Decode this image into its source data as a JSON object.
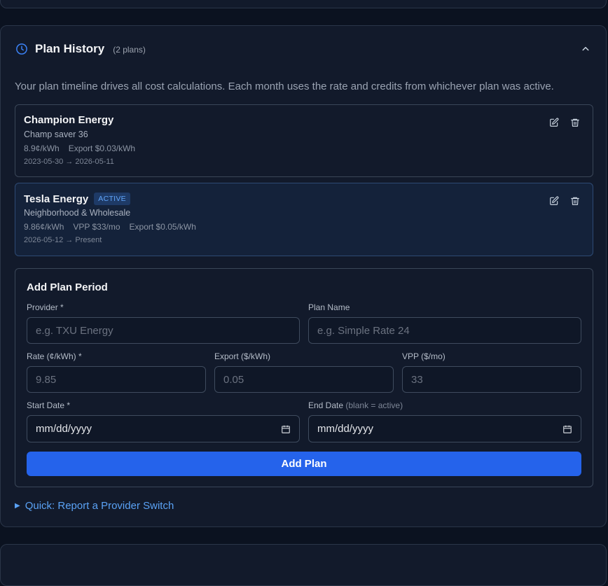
{
  "section": {
    "title": "Plan History",
    "count": "(2 plans)",
    "description": "Your plan timeline drives all cost calculations. Each month uses the rate and credits from whichever plan was active."
  },
  "plans": [
    {
      "provider": "Champion Energy",
      "plan_name": "Champ saver 36",
      "rate": "8.9¢/kWh",
      "export": "Export $0.03/kWh",
      "dates": "2023-05-30 → 2026-05-11"
    },
    {
      "provider": "Tesla Energy",
      "badge": "ACTIVE",
      "plan_name": "Neighborhood & Wholesale",
      "rate": "9.86¢/kWh",
      "vpp": "VPP $33/mo",
      "export": "Export $0.05/kWh",
      "dates": "2026-05-12 → Present"
    }
  ],
  "form": {
    "title": "Add Plan Period",
    "provider_label": "Provider *",
    "provider_placeholder": "e.g. TXU Energy",
    "plan_name_label": "Plan Name",
    "plan_name_placeholder": "e.g. Simple Rate 24",
    "rate_label": "Rate (¢/kWh) *",
    "rate_placeholder": "9.85",
    "export_label": "Export ($/kWh)",
    "export_placeholder": "0.05",
    "vpp_label": "VPP ($/mo)",
    "vpp_placeholder": "33",
    "start_label": "Start Date *",
    "start_value": "mm/dd/yyyy",
    "end_label": "End Date",
    "end_hint": "(blank = active)",
    "end_value": "mm/dd/yyyy",
    "submit_label": "Add Plan"
  },
  "quick_link": {
    "label": "Quick: Report a Provider Switch"
  },
  "colors": {
    "accent": "#2563eb",
    "link": "#5aa2f5",
    "badge_text": "#60a5fa",
    "badge_bg": "#1e3a66"
  },
  "icons": {
    "header": "clock-icon",
    "collapse": "chevron-up-icon",
    "edit": "edit-icon",
    "delete": "trash-icon",
    "date": "calendar-icon"
  }
}
